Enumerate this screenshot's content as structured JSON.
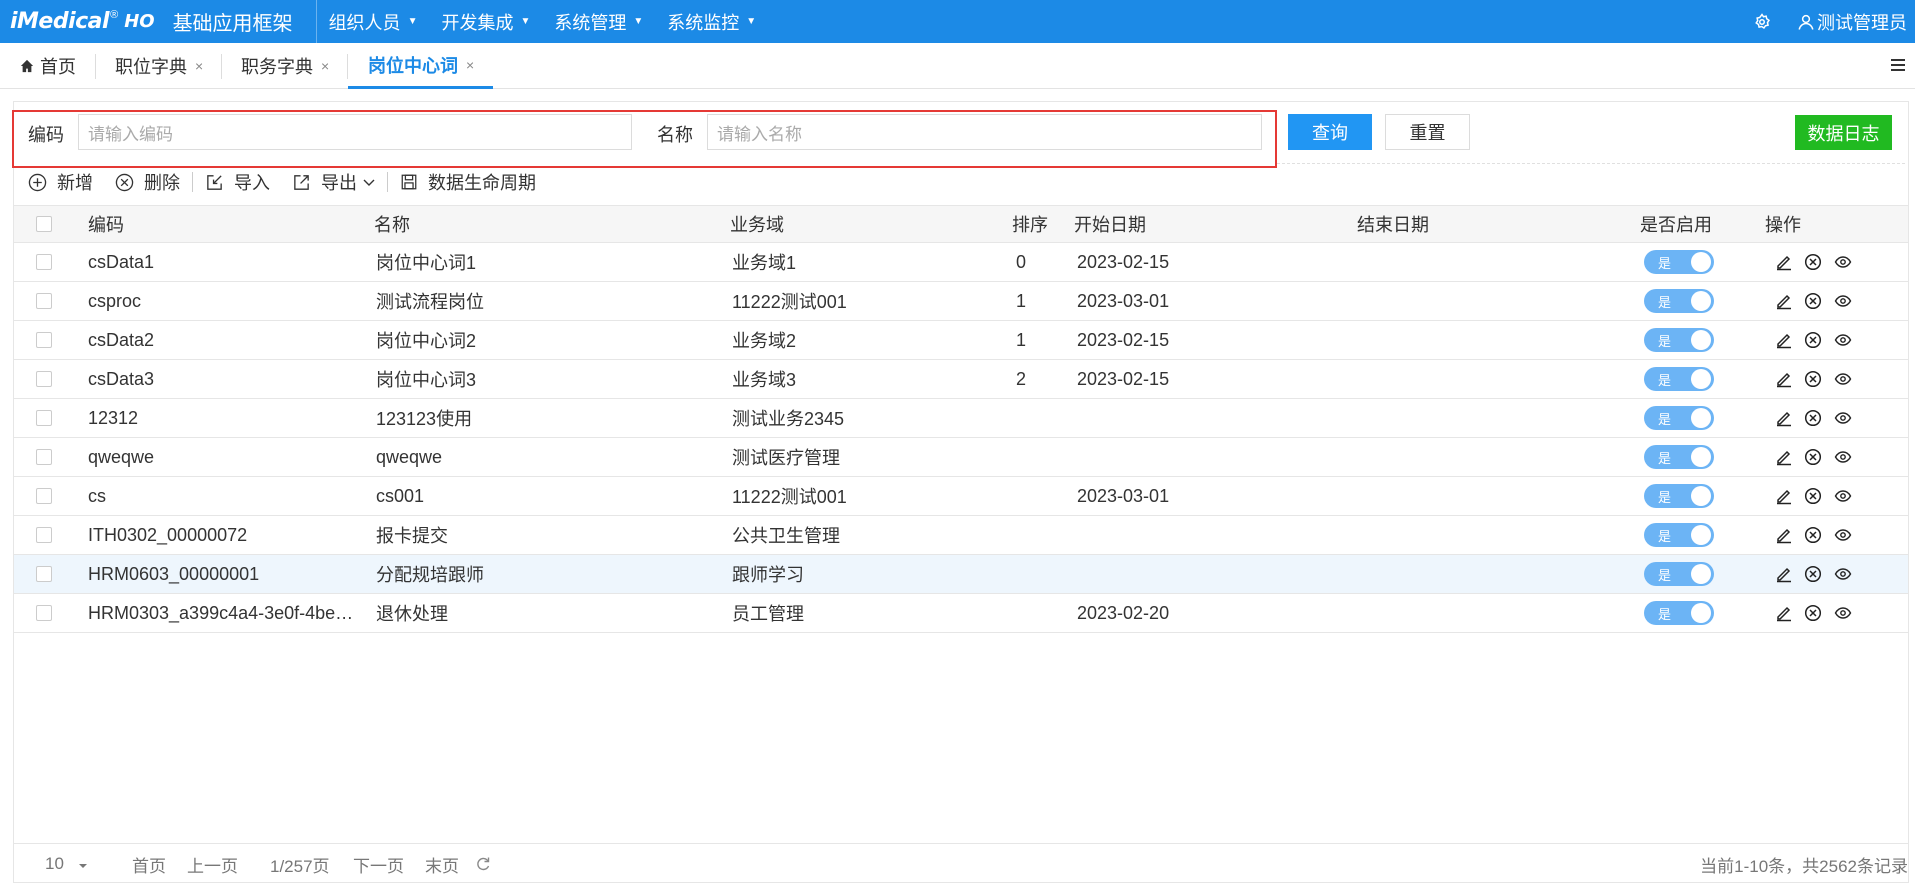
{
  "header": {
    "logo_text": "iMedical",
    "logo_reg": "®",
    "logo_suffix": "HO",
    "app_title": "基础应用框架",
    "nav": [
      "组织人员",
      "开发集成",
      "系统管理",
      "系统监控"
    ],
    "user": "测试管理员"
  },
  "tabs": {
    "home": "首页",
    "items": [
      "职位字典",
      "职务字典",
      "岗位中心词"
    ],
    "active": "岗位中心词",
    "close": "×"
  },
  "search": {
    "code_label": "编码",
    "code_placeholder": "请输入编码",
    "name_label": "名称",
    "name_placeholder": "请输入名称",
    "query_button": "查询",
    "reset_button": "重置",
    "log_button": "数据日志"
  },
  "toolbar": {
    "add": "新增",
    "delete": "删除",
    "import": "导入",
    "export": "导出",
    "lifecycle": "数据生命周期"
  },
  "table": {
    "columns": [
      "编码",
      "名称",
      "业务域",
      "排序",
      "开始日期",
      "结束日期",
      "是否启用",
      "操作"
    ],
    "rows": [
      {
        "code": "csData1",
        "name": "岗位中心词1",
        "domain": "业务域1",
        "sort": "0",
        "start": "2023-02-15",
        "end": "",
        "enabled": "是"
      },
      {
        "code": "csproc",
        "name": "测试流程岗位",
        "domain": "11222测试001",
        "sort": "1",
        "start": "2023-03-01",
        "end": "",
        "enabled": "是"
      },
      {
        "code": "csData2",
        "name": "岗位中心词2",
        "domain": "业务域2",
        "sort": "1",
        "start": "2023-02-15",
        "end": "",
        "enabled": "是"
      },
      {
        "code": "csData3",
        "name": "岗位中心词3",
        "domain": "业务域3",
        "sort": "2",
        "start": "2023-02-15",
        "end": "",
        "enabled": "是"
      },
      {
        "code": "12312",
        "name": "123123使用",
        "domain": "测试业务2345",
        "sort": "",
        "start": "",
        "end": "",
        "enabled": "是"
      },
      {
        "code": "qweqwe",
        "name": "qweqwe",
        "domain": "测试医疗管理",
        "sort": "",
        "start": "",
        "end": "",
        "enabled": "是"
      },
      {
        "code": "cs",
        "name": "cs001",
        "domain": "11222测试001",
        "sort": "",
        "start": "2023-03-01",
        "end": "",
        "enabled": "是"
      },
      {
        "code": "ITH0302_00000072",
        "name": "报卡提交",
        "domain": "公共卫生管理",
        "sort": "",
        "start": "",
        "end": "",
        "enabled": "是"
      },
      {
        "code": "HRM0603_00000001",
        "name": "分配规培跟师",
        "domain": "跟师学习",
        "sort": "",
        "start": "",
        "end": "",
        "enabled": "是"
      },
      {
        "code": "HRM0303_a399c4a4-3e0f-4be…",
        "name": "退休处理",
        "domain": "员工管理",
        "sort": "",
        "start": "2023-02-20",
        "end": "",
        "enabled": "是"
      }
    ]
  },
  "footer": {
    "page_size": "10",
    "first": "首页",
    "prev": "上一页",
    "page_info": "1/257页",
    "next": "下一页",
    "last": "末页",
    "summary": "当前1-10条，共2562条记录"
  },
  "colors": {
    "brand": "#1c8ae6",
    "primary_button": "#2196f3",
    "log_button": "#21ba21",
    "highlight_border": "#e53935",
    "toggle_on": "#6cb4f5"
  }
}
